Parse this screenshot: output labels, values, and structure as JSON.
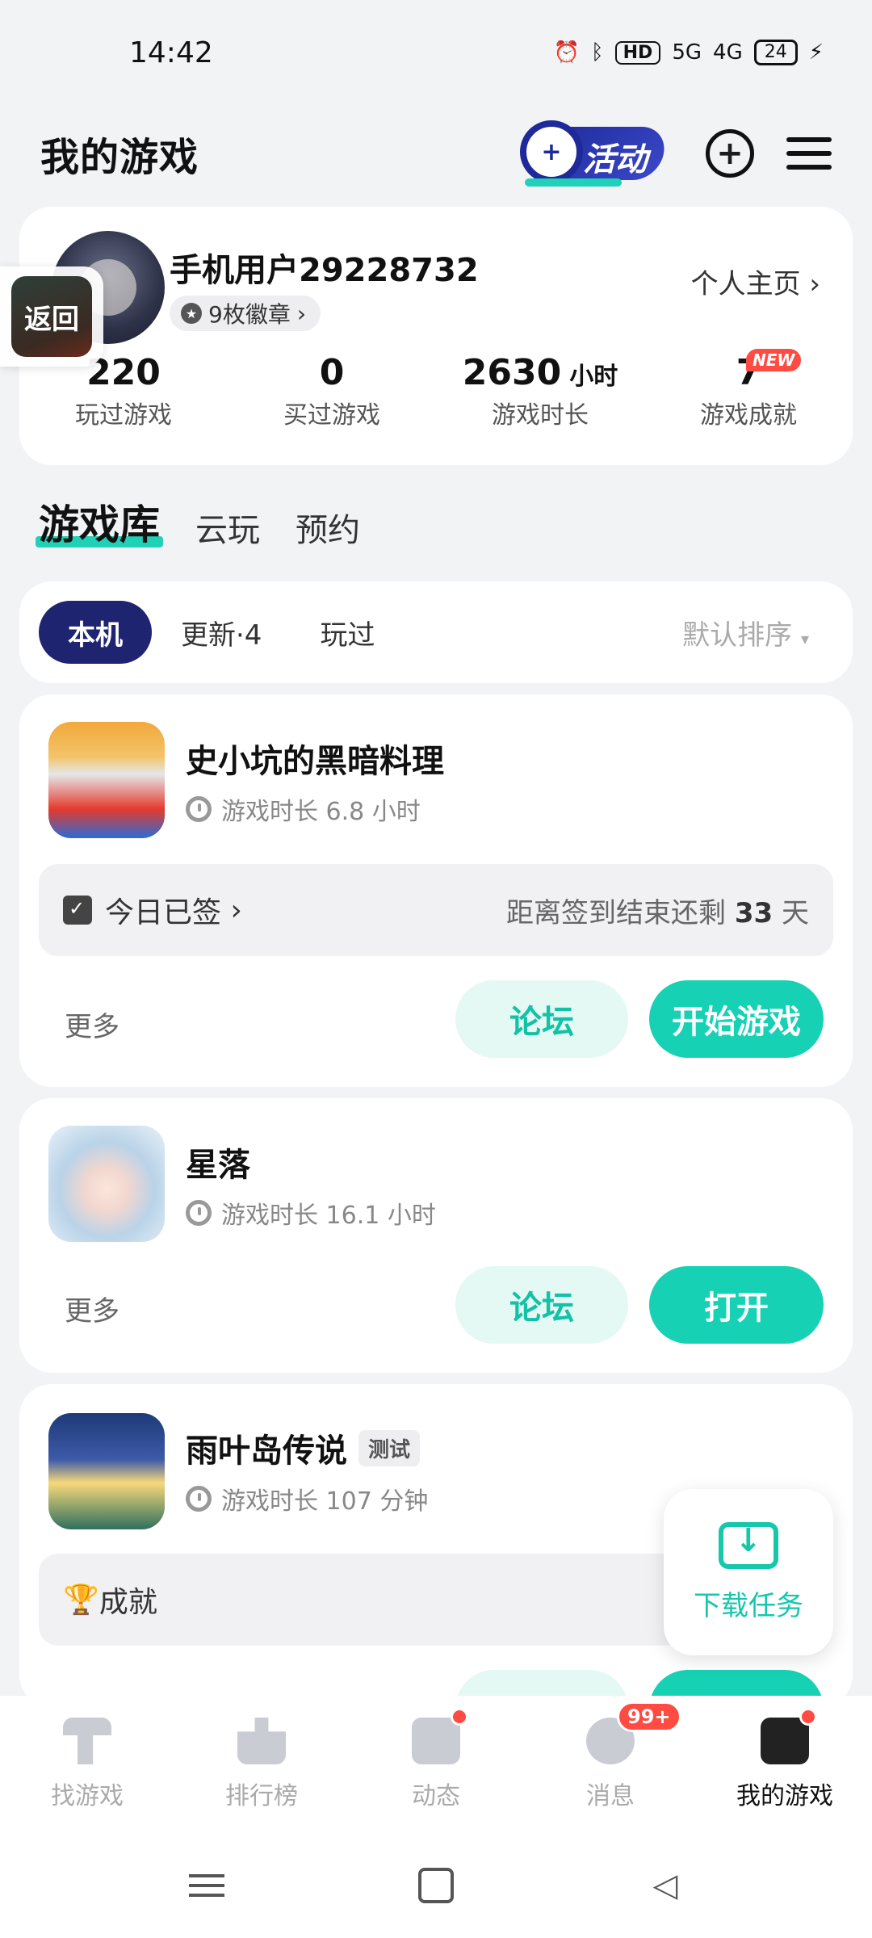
{
  "status": {
    "time": "14:42",
    "net1": "5G",
    "net2": "4G",
    "battery": "24"
  },
  "header": {
    "title": "我的游戏",
    "activity_label": "活动"
  },
  "profile": {
    "username": "手机用户29228732",
    "badges": "9枚徽章",
    "home_link": "个人主页",
    "back_label": "返回",
    "stats": [
      {
        "value": "220",
        "unit": "",
        "label": "玩过游戏"
      },
      {
        "value": "0",
        "unit": "",
        "label": "买过游戏"
      },
      {
        "value": "2630",
        "unit": "小时",
        "label": "游戏时长"
      },
      {
        "value": "7",
        "unit": "",
        "label": "游戏成就",
        "tag": "NEW"
      }
    ]
  },
  "library_tabs": [
    "游戏库",
    "云玩",
    "预约"
  ],
  "filters": {
    "chips": [
      "本机",
      "更新·4",
      "玩过"
    ],
    "sort": "默认排序"
  },
  "games": [
    {
      "name": "史小坑的黑暗料理",
      "playtime": "游戏时长 6.8 小时",
      "sign_left": "今日已签",
      "sign_right_prefix": "距离签到结束还剩",
      "sign_days": "33",
      "sign_right_suffix": "天",
      "more": "更多",
      "forum": "论坛",
      "action": "开始游戏"
    },
    {
      "name": "星落",
      "playtime": "游戏时长 16.1 小时",
      "more": "更多",
      "forum": "论坛",
      "action": "打开"
    },
    {
      "name": "雨叶岛传说",
      "tag": "测试",
      "playtime": "游戏时长 107 分钟",
      "achievement": "成就"
    }
  ],
  "download_task": "下载任务",
  "bottom_tabs": [
    {
      "label": "找游戏"
    },
    {
      "label": "排行榜"
    },
    {
      "label": "动态"
    },
    {
      "label": "消息",
      "badge": "99+"
    },
    {
      "label": "我的游戏"
    }
  ]
}
